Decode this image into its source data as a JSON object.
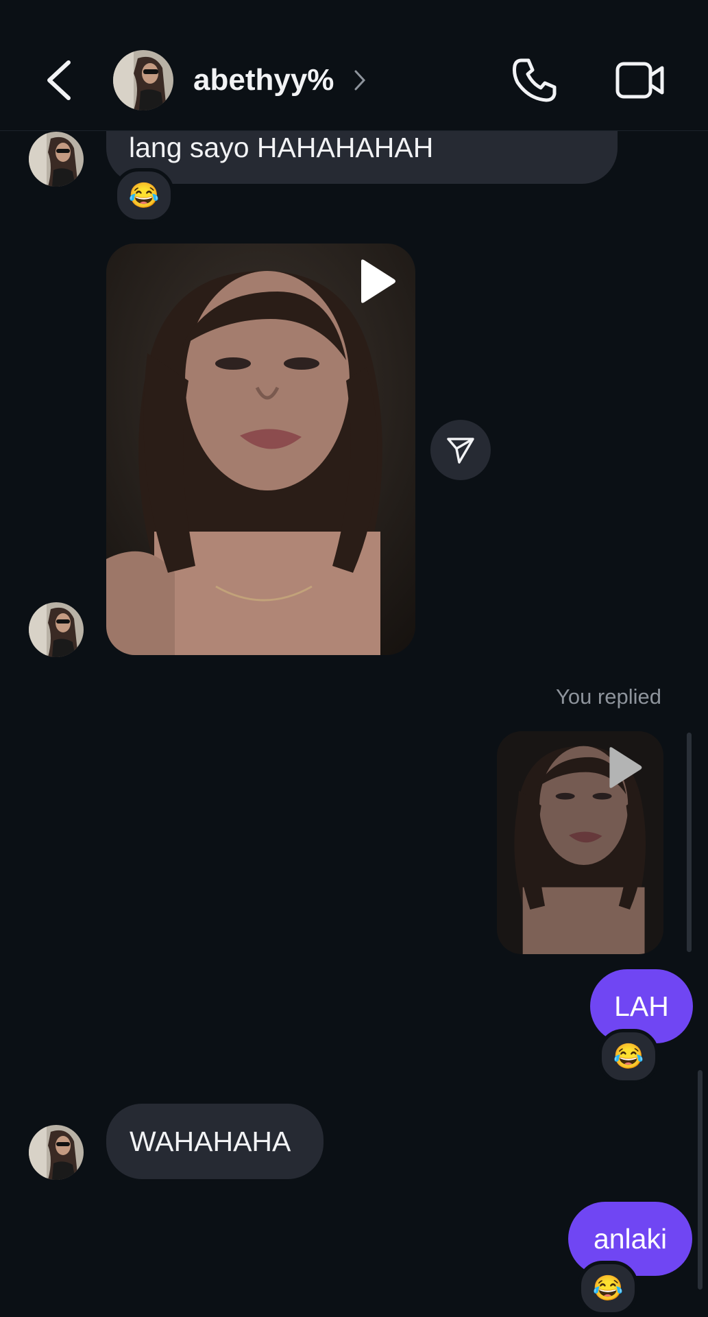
{
  "header": {
    "username": "abethyy%",
    "back_icon": "chevron-left-icon",
    "call_icon": "phone-icon",
    "video_icon": "video-camera-icon"
  },
  "messages": {
    "msg1_text": "lang sayo HAHAHAHAH",
    "msg1_reaction": "😂",
    "replied_label": "You replied",
    "out1_text": "LAH",
    "out1_reaction": "😂",
    "in2_text": "WAHAHAHA",
    "out2_text": "anlaki",
    "out2_reaction": "😂"
  },
  "colors": {
    "background": "#0b1015",
    "incoming_bubble": "#262a33",
    "outgoing_bubble": "#7046f3"
  }
}
